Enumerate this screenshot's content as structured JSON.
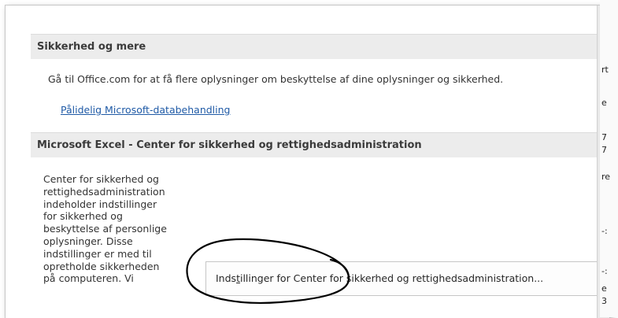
{
  "security_section": {
    "header": "Sikkerhed og mere",
    "info_text": "Gå til Office.com for at få flere oplysninger om beskyttelse af dine oplysninger og sikkerhed.",
    "link_label": "Pålidelig Microsoft-databehandling"
  },
  "trust_center_section": {
    "header": "Microsoft Excel - Center for sikkerhed og rettighedsadministration",
    "description_lines": [
      "Center for sikkerhed og",
      "rettighedsadministration",
      "indeholder indstillinger",
      "for sikkerhed og",
      "beskyttelse af personlige",
      "oplysninger. Disse",
      "indstillinger er med til",
      "opretholde sikkerheden",
      "på computeren. Vi"
    ],
    "button_label_prefix": "Inds",
    "button_label_access_key": "t",
    "button_label_suffix": "illinger for Center for sikkerhed og rettighedsadministration..."
  },
  "background_sheet": {
    "cells": [
      "rt",
      "e",
      "7",
      "7",
      "re",
      "-:",
      "-:",
      "e",
      "3"
    ]
  },
  "colors": {
    "section_header_bg": "#ececec",
    "link": "#1f5aa6",
    "annotation_oval": "#000000"
  }
}
